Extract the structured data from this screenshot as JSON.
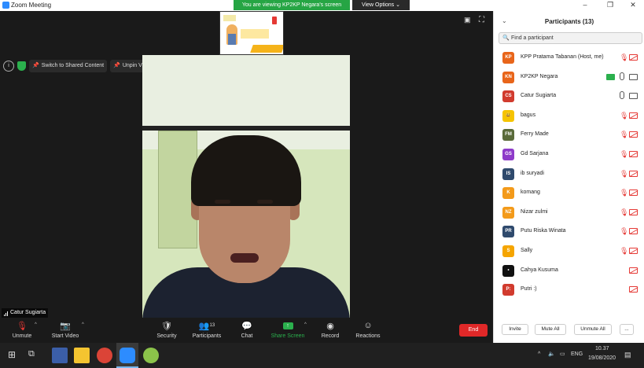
{
  "window": {
    "title": "Zoom Meeting",
    "minimize": "–",
    "maximize": "❐",
    "close": "✕"
  },
  "share_banner": {
    "text": "You are viewing KP2KP Negara's screen",
    "view_options": "View Options ⌄"
  },
  "stage_controls": {
    "switch_label": "Switch to Shared Content",
    "unpin_label": "Unpin Video",
    "info_glyph": "i"
  },
  "active_speaker": {
    "name": "Catur Sugiarta"
  },
  "toolbar": {
    "unmute": "Unmute",
    "start_video": "Start Video",
    "security": "Security",
    "participants": "Participants",
    "participants_count": "13",
    "chat": "Chat",
    "share_screen": "Share Screen",
    "record": "Record",
    "reactions": "Reactions",
    "end": "End"
  },
  "panel": {
    "title": "Participants (13)",
    "search_placeholder": "Find a participant",
    "participants": [
      {
        "initials": "KP",
        "name": "KPP Pratama Tabanan (Host, me)",
        "color": "#e8651a",
        "mic": "off",
        "video": "off"
      },
      {
        "initials": "KN",
        "name": "KP2KP Negara",
        "color": "#e8651a",
        "mic": "on",
        "video": "on",
        "sharing": true
      },
      {
        "initials": "CS",
        "name": "Catur Sugiarta",
        "color": "#d13b2e",
        "mic": "on",
        "video": "on"
      },
      {
        "initials": "😃",
        "name": "bagus",
        "color": "#f5c400",
        "mic": "off",
        "video": "off"
      },
      {
        "initials": "FM",
        "name": "Ferry Made",
        "color": "#5a6b3a",
        "mic": "off",
        "video": "off"
      },
      {
        "initials": "GS",
        "name": "Gd Sarjana",
        "color": "#8e3bc9",
        "mic": "off",
        "video": "off"
      },
      {
        "initials": "IS",
        "name": "ib suryadi",
        "color": "#2f4a6d",
        "mic": "off",
        "video": "off"
      },
      {
        "initials": "K",
        "name": "komang",
        "color": "#f39a1a",
        "mic": "off",
        "video": "off"
      },
      {
        "initials": "NZ",
        "name": "Nizar zulmi",
        "color": "#f39a1a",
        "mic": "off",
        "video": "off"
      },
      {
        "initials": "PR",
        "name": "Putu Riska Winata",
        "color": "#2f4a6d",
        "mic": "off",
        "video": "off"
      },
      {
        "initials": "S",
        "name": "Sally",
        "color": "#f5a500",
        "mic": "off",
        "video": "off"
      },
      {
        "initials": "•",
        "name": "Cahya Kusuma",
        "color": "#111111",
        "mic": "none",
        "video": "off"
      },
      {
        "initials": "P:",
        "name": "Putri :)",
        "color": "#d13b2e",
        "mic": "none",
        "video": "off"
      }
    ],
    "footer": {
      "invite": "Invite",
      "mute_all": "Mute All",
      "unmute_all": "Unmute All",
      "more": "..."
    }
  },
  "taskbar": {
    "lang": "ENG",
    "time": "10.37",
    "date": "19/08/2020"
  }
}
